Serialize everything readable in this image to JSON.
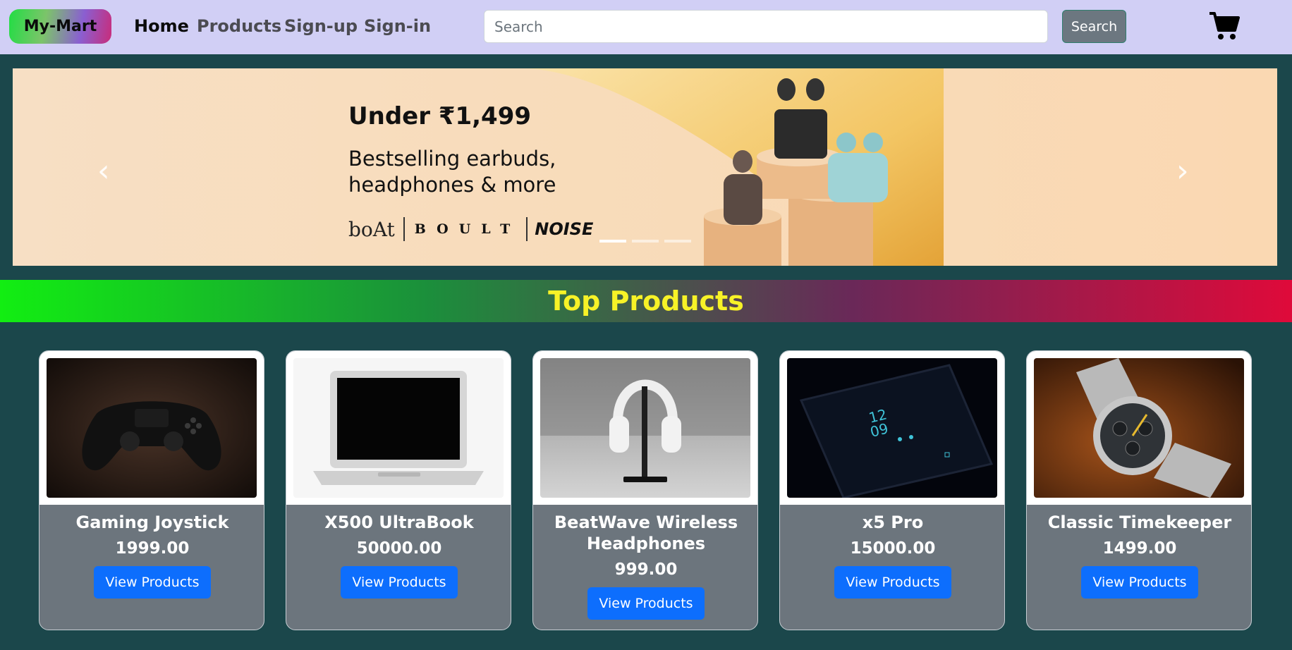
{
  "navbar": {
    "brand": "My-Mart",
    "links": [
      "Home",
      "Products",
      "Sign-up",
      "Sign-in"
    ],
    "active_link": "Home",
    "search_placeholder": "Search",
    "search_button": "Search",
    "cart_icon": "shopping-cart-icon"
  },
  "carousel": {
    "title": "Under ₹1,499",
    "subtitle_line1": "Bestselling earbuds,",
    "subtitle_line2": "headphones & more",
    "brands": [
      "boAt",
      "BOULT",
      "NOISE"
    ],
    "prev_icon": "chevron-left-icon",
    "next_icon": "chevron-right-icon",
    "slide_count": 3,
    "active_slide": 1
  },
  "section": {
    "title": "Top Products"
  },
  "products": [
    {
      "name": "Gaming Joystick",
      "price": "1999.00",
      "button": "View Products",
      "image": "gamepad-image"
    },
    {
      "name": "X500 UltraBook",
      "price": "50000.00",
      "button": "View Products",
      "image": "laptop-image"
    },
    {
      "name": "BeatWave Wireless Headphones",
      "price": "999.00",
      "button": "View Products",
      "image": "headphones-image"
    },
    {
      "name": "x5 Pro",
      "price": "15000.00",
      "button": "View Products",
      "image": "smartphone-image"
    },
    {
      "name": "Classic Timekeeper",
      "price": "1499.00",
      "button": "View Products",
      "image": "watch-image"
    }
  ],
  "colors": {
    "navbar_bg": "#d1cff5",
    "page_bg": "#1b474b",
    "card_body": "#6c757d",
    "primary_button": "#0d6efd",
    "section_title": "#f7f227"
  }
}
